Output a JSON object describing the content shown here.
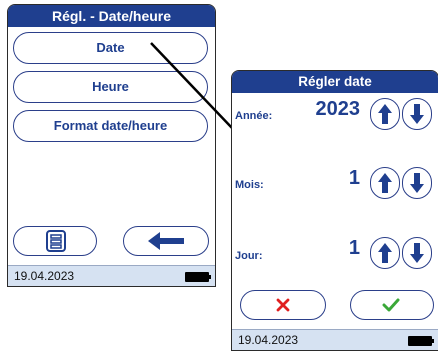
{
  "screen1": {
    "title": "Régl. - Date/heure",
    "menu": [
      "Date",
      "Heure",
      "Format date/heure"
    ],
    "status_date": "19.04.2023"
  },
  "screen2": {
    "title": "Régler date",
    "fields": [
      {
        "label": "Année:",
        "value": "2023"
      },
      {
        "label": "Mois:",
        "value": "1"
      },
      {
        "label": "Jour:",
        "value": "1"
      }
    ],
    "status_date": "19.04.2023"
  },
  "icons": {
    "menu_list": "list-icon",
    "back": "left-arrow-icon",
    "up": "up-arrow-icon",
    "down": "down-arrow-icon",
    "cancel": "red-x-icon",
    "confirm": "green-check-icon",
    "battery": "battery-icon"
  },
  "colors": {
    "title_bar": "#1f3f8f",
    "accent_text": "#1f3f8f",
    "status_bar": "#d6e2f2",
    "cancel": "#e02020",
    "confirm": "#3aa838"
  }
}
